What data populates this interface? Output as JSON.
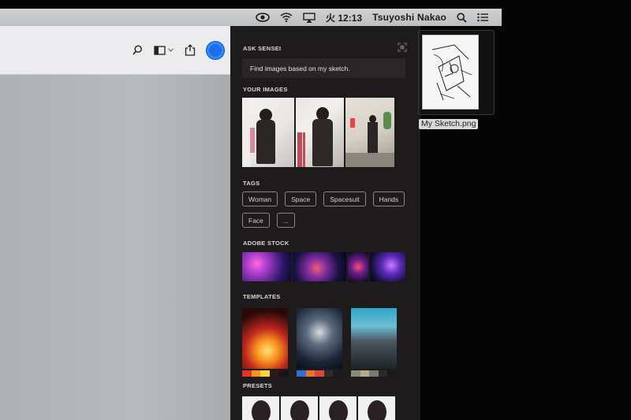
{
  "menubar": {
    "clock": "火 12:13",
    "user": "Tsuyoshi Nakao",
    "icons": [
      "eye-icon",
      "wifi-icon",
      "airplay-icon",
      "search-icon",
      "list-icon"
    ]
  },
  "sensei": {
    "title": "ASK SENSEI",
    "query": "Find images based on my sketch.",
    "your_images_title": "YOUR IMAGES",
    "tags_title": "TAGS",
    "tags": [
      "Woman",
      "Space",
      "Spacesuit",
      "Hands",
      "Face",
      "..."
    ],
    "stock_title": "ADOBE STOCK",
    "templates_title": "TEMPLATES",
    "presets_title": "PRESETS"
  },
  "desktop": {
    "file_name": "My Sketch.png"
  },
  "colors": {
    "panel_bg": "#1e1b1d",
    "menubar_bg": "#c8cacc",
    "accent_blue": "#1d6fe6"
  }
}
